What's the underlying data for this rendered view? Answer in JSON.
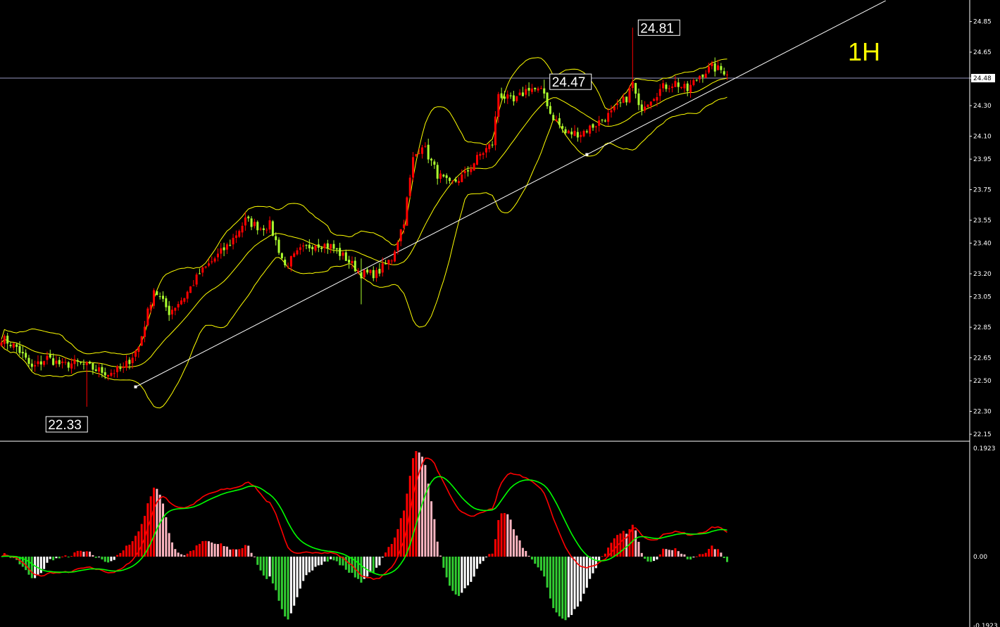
{
  "timeframe_label": "1H",
  "colors": {
    "background": "#000000",
    "bull_candle": "#ff0000",
    "bear_candle": "#adff2f",
    "bollinger": "#ffff00",
    "trendline": "#ffffff",
    "hline": "#c8c8ff",
    "macd_line": "#ff0000",
    "signal_line": "#00ff00",
    "hist_pos_rising": "#ff0000",
    "hist_pos_falling": "#ffb6c1",
    "hist_neg_falling": "#32cd32",
    "hist_neg_rising": "#ffffff"
  },
  "chart_data": [
    {
      "type": "candlestick",
      "title": "1H",
      "price_axis_ticks": [
        "24.85",
        "24.65",
        "24.48",
        "24.30",
        "24.10",
        "23.95",
        "23.75",
        "23.55",
        "23.40",
        "23.20",
        "23.05",
        "22.85",
        "22.65",
        "22.50",
        "22.30",
        "22.15"
      ],
      "current_price": "24.48",
      "ylim": [
        22.12,
        24.92
      ],
      "annotations": [
        {
          "text": "24.81",
          "price": 24.81,
          "bar": 207
        },
        {
          "text": "24.47",
          "price": 24.47,
          "bar": 178
        },
        {
          "text": "22.33",
          "price": 22.33,
          "bar": 28
        }
      ],
      "close_anchors": [
        [
          0,
          22.78
        ],
        [
          5,
          22.72
        ],
        [
          10,
          22.58
        ],
        [
          15,
          22.65
        ],
        [
          20,
          22.6
        ],
        [
          25,
          22.62
        ],
        [
          30,
          22.58
        ],
        [
          35,
          22.55
        ],
        [
          40,
          22.58
        ],
        [
          45,
          22.72
        ],
        [
          50,
          23.1
        ],
        [
          55,
          22.95
        ],
        [
          60,
          23.05
        ],
        [
          65,
          23.2
        ],
        [
          70,
          23.3
        ],
        [
          75,
          23.4
        ],
        [
          80,
          23.55
        ],
        [
          85,
          23.5
        ],
        [
          88,
          23.52
        ],
        [
          93,
          23.25
        ],
        [
          98,
          23.35
        ],
        [
          103,
          23.4
        ],
        [
          108,
          23.38
        ],
        [
          113,
          23.3
        ],
        [
          118,
          23.2
        ],
        [
          123,
          23.2
        ],
        [
          128,
          23.3
        ],
        [
          132,
          23.55
        ],
        [
          135,
          23.95
        ],
        [
          138,
          24.05
        ],
        [
          143,
          23.85
        ],
        [
          147,
          23.78
        ],
        [
          152,
          23.85
        ],
        [
          157,
          23.98
        ],
        [
          161,
          24.05
        ],
        [
          163,
          24.38
        ],
        [
          168,
          24.32
        ],
        [
          173,
          24.42
        ],
        [
          178,
          24.38
        ],
        [
          180,
          24.25
        ],
        [
          185,
          24.12
        ],
        [
          190,
          24.12
        ],
        [
          195,
          24.18
        ],
        [
          200,
          24.25
        ],
        [
          205,
          24.35
        ],
        [
          207,
          24.45
        ],
        [
          209,
          24.28
        ],
        [
          213,
          24.35
        ],
        [
          217,
          24.42
        ],
        [
          221,
          24.45
        ],
        [
          225,
          24.4
        ],
        [
          229,
          24.5
        ],
        [
          233,
          24.55
        ],
        [
          238,
          24.52
        ]
      ],
      "bars": 239,
      "bollinger_bands": {
        "period": 20,
        "deviations": 2
      },
      "trendline": {
        "from": {
          "bar": 44,
          "price": 22.46
        },
        "to": {
          "bar": 192,
          "price": 23.98
        }
      }
    },
    {
      "type": "macd",
      "axis_ticks": [
        "0.1923",
        "0.00",
        "-0.1923"
      ],
      "ylim": [
        -0.1923,
        0.1923
      ],
      "series": [
        "histogram",
        "macd",
        "signal"
      ]
    }
  ]
}
